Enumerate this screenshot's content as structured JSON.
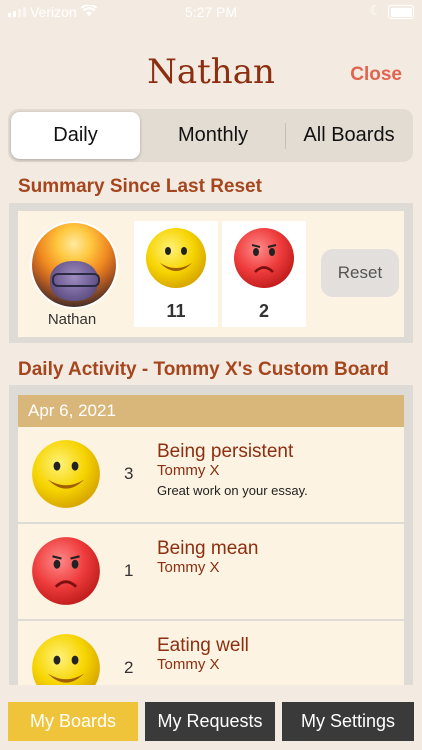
{
  "status_bar": {
    "carrier": "Verizon",
    "time": "5:27 PM"
  },
  "header": {
    "title": "Nathan",
    "close_label": "Close"
  },
  "segments": [
    {
      "label": "Daily",
      "selected": true
    },
    {
      "label": "Monthly",
      "selected": false
    },
    {
      "label": "All Boards",
      "selected": false
    }
  ],
  "summary": {
    "title": "Summary Since Last Reset",
    "name": "Nathan",
    "happy_count": "11",
    "sad_count": "2",
    "reset_label": "Reset"
  },
  "activity": {
    "title": "Daily Activity - Tommy X's Custom Board",
    "date": "Apr 6, 2021",
    "items": [
      {
        "face": "happy",
        "count": "3",
        "behavior": "Being persistent",
        "owner": "Tommy X",
        "note": "Great work on your essay."
      },
      {
        "face": "sad",
        "count": "1",
        "behavior": "Being mean",
        "owner": "Tommy X",
        "note": ""
      },
      {
        "face": "happy",
        "count": "2",
        "behavior": "Eating well",
        "owner": "Tommy X",
        "note": ""
      }
    ]
  },
  "bottom_nav": [
    {
      "label": "My Boards",
      "active": true
    },
    {
      "label": "My Requests",
      "active": false
    },
    {
      "label": "My Settings",
      "active": false
    }
  ],
  "colors": {
    "accent": "#8b2f10",
    "section_title": "#a5461e",
    "close": "#e06450",
    "date_bar": "#d9b77a",
    "nav_active": "#f0c43a",
    "nav_inactive": "#3a3a3a"
  }
}
